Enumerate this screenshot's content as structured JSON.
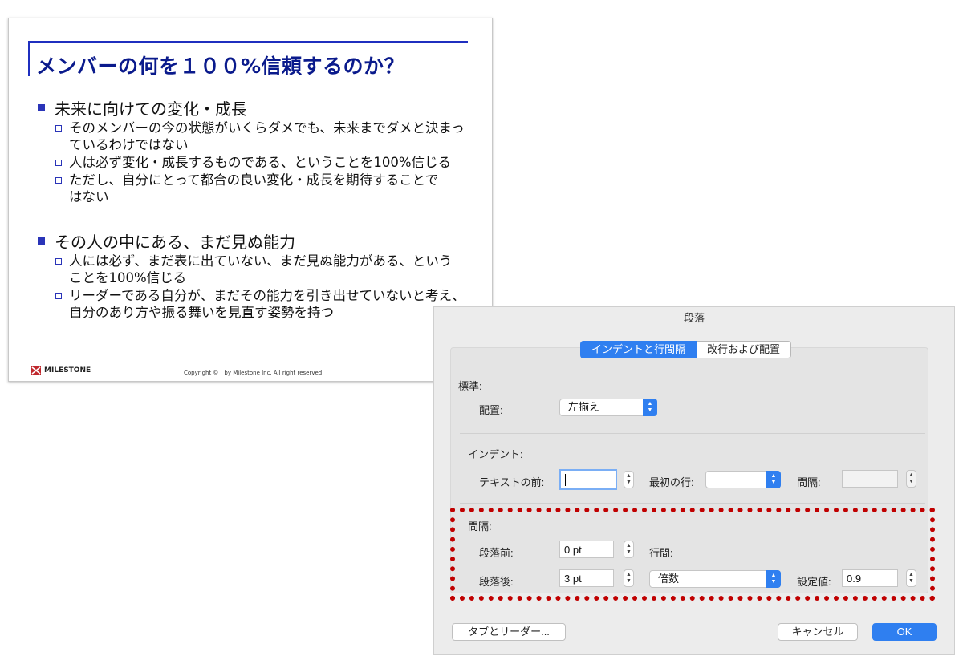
{
  "slide": {
    "title": "メンバーの何を１００%信頼するのか？",
    "sections": [
      {
        "heading": "未来に向けての変化・成長",
        "items": [
          "そのメンバーの今の状態がいくらダメでも、未来までダメと決まっ\nているわけではない",
          "人は必ず変化・成長するものである、ということを100%信じる",
          "ただし、自分にとって都合の良い変化・成長を期待することで\nはない"
        ]
      },
      {
        "heading": "その人の中にある、まだ見ぬ能力",
        "items": [
          "人には必ず、まだ表に出ていない、まだ見ぬ能力がある、という\nことを100%信じる",
          "リーダーである自分が、まだその能力を引き出せていないと考え、\n自分のあり方や振る舞いを見直す姿勢を持つ"
        ]
      }
    ],
    "logo_text": "MILESTONE",
    "copyright": "Copyright ©　by Milestone Inc. All right reserved."
  },
  "dialog": {
    "title": "段落",
    "tabs": [
      {
        "label": "インデントと行間隔",
        "active": true
      },
      {
        "label": "改行および配置",
        "active": false
      }
    ],
    "general": {
      "heading": "標準:",
      "alignment_label": "配置:",
      "alignment_value": "左揃え"
    },
    "indent": {
      "heading": "インデント:",
      "before_text_label": "テキストの前:",
      "before_text_value": "",
      "first_line_label": "最初の行:",
      "first_line_value": "",
      "by_label": "間隔:",
      "by_value": ""
    },
    "spacing": {
      "heading": "間隔:",
      "before_label": "段落前:",
      "before_value": "0 pt",
      "line_label": "行間:",
      "after_label": "段落後:",
      "after_value": "3 pt",
      "line_value": "倍数",
      "at_label": "設定値:",
      "at_value": "0.9"
    },
    "buttons": {
      "tabs_leaders": "タブとリーダー...",
      "cancel": "キャンセル",
      "ok": "OK"
    }
  },
  "colors": {
    "slide_title": "#0a1a8c",
    "bullet": "#2a34b8",
    "accent": "#2f7ff0",
    "highlight_box": "#c00000"
  }
}
